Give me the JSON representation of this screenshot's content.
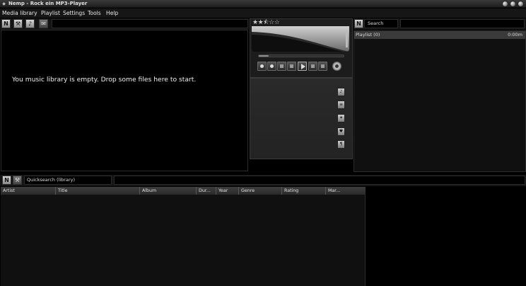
{
  "window": {
    "title": "Nemp - Rock ein MP3-Player"
  },
  "menu": [
    "Media library",
    "Playlist",
    "Settings",
    "Tools",
    "Help"
  ],
  "toolbar": {
    "n_button": "N",
    "tool_glyphs": [
      "⚒",
      "♪",
      "✉"
    ]
  },
  "library": {
    "empty_message": "You music library is empty. Drop some files here to start."
  },
  "player": {
    "rating": "★★⯪☆☆",
    "rating_value": 2.5,
    "progress": 0.12,
    "accent_color": "#8a8a8a"
  },
  "playlist": {
    "n_button": "N",
    "search_label": "Search",
    "row_name": "Playlist (0)",
    "row_duration": "0:00m"
  },
  "quicksearch": {
    "n_button": "N",
    "tool_glyph": "⚒",
    "label": "Quicksearch (library)"
  },
  "table": {
    "columns": [
      "Artist",
      "Title",
      "Album",
      "Dur...",
      "Year",
      "Genre",
      "Rating",
      "Mar..."
    ]
  }
}
